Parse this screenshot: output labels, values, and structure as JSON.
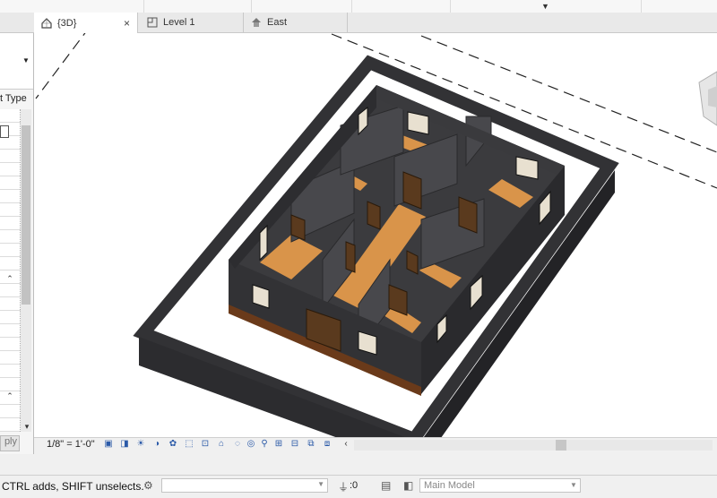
{
  "tabs": [
    {
      "label": "{3D}",
      "icon": "house-3d-icon",
      "active": true
    },
    {
      "label": "Level 1",
      "icon": "floor-plan-icon",
      "active": false
    },
    {
      "label": "East",
      "icon": "elevation-icon",
      "active": false
    }
  ],
  "properties_panel": {
    "type_label": "t Type",
    "apply_label": "ply"
  },
  "view_control": {
    "scale": "1/8\" = 1'-0\""
  },
  "status_bar": {
    "message": "CTRL adds, SHIFT unselects.",
    "selection_count": ":0",
    "model": "Main Model"
  },
  "colors": {
    "wall": "#3b3b3e",
    "floor": "#d9944a",
    "door": "#5a3a1e",
    "accent": "#2b5aa8"
  }
}
